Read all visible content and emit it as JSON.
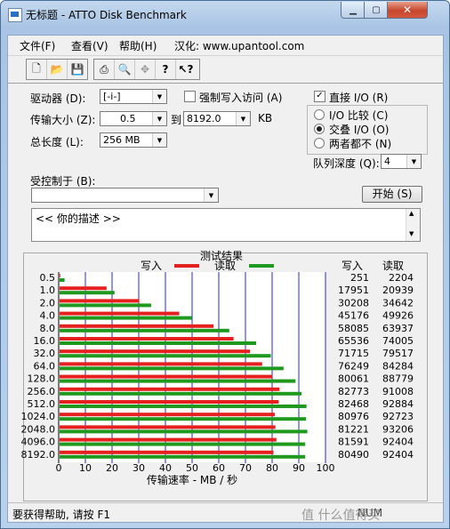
{
  "window": {
    "title": "无标题 - ATTO Disk Benchmark"
  },
  "menu": [
    "文件(F)",
    "查看(V)",
    "帮助(H)",
    "汉化: www.upantool.com"
  ],
  "toolbar": {
    "icons": [
      "new-file-icon",
      "open-folder-icon",
      "save-icon",
      "print-icon",
      "print-preview-icon",
      "move-icon",
      "help-icon",
      "context-help-icon"
    ]
  },
  "form": {
    "drive_label": "驱动器 (D):",
    "drive_value": "[-i-]",
    "force_write_label": "强制写入访问 (A)",
    "direct_io_label": "直接 I/O (R)",
    "direct_io_checked": true,
    "transfer_label": "传输大小 (Z):",
    "transfer_from": "0.5",
    "to_label": "到",
    "transfer_to": "8192.0",
    "kb_label": "KB",
    "length_label": "总长度 (L):",
    "length_value": "256 MB",
    "io_compare_label": "I/O 比较 (C)",
    "overlapped_io_label": "交叠 I/O (O)",
    "neither_label": "两者都不 (N)",
    "queue_depth_label": "队列深度 (Q):",
    "queue_depth_value": "4",
    "controlled_by_label": "受控制于 (B):",
    "start_button": "开始 (S)",
    "description_text": "<<  你的描述  >>"
  },
  "chart_data": {
    "type": "bar",
    "title": "测试结果",
    "legend": {
      "write": "写入",
      "read": "读取",
      "placement": "top"
    },
    "columns": {
      "write": "写入",
      "read": "读取"
    },
    "xlabel": "传输速率 - MB / 秒",
    "xlim": [
      0,
      100
    ],
    "xticks": [
      "0",
      "10",
      "20",
      "30",
      "40",
      "50",
      "60",
      "70",
      "80",
      "90",
      "100"
    ],
    "categories": [
      "0.5",
      "1.0",
      "2.0",
      "4.0",
      "8.0",
      "16.0",
      "32.0",
      "64.0",
      "128.0",
      "256.0",
      "512.0",
      "1024.0",
      "2048.0",
      "4096.0",
      "8192.0"
    ],
    "series": [
      {
        "name": "写入",
        "color": "#e61f1f",
        "values": [
          0.251,
          17.951,
          30.208,
          45.176,
          58.085,
          65.536,
          71.715,
          76.249,
          80.061,
          82.773,
          82.468,
          80.976,
          81.221,
          81.591,
          80.49
        ],
        "raw": [
          "251",
          "17951",
          "30208",
          "45176",
          "58085",
          "65536",
          "71715",
          "76249",
          "80061",
          "82773",
          "82468",
          "80976",
          "81221",
          "81591",
          "80490"
        ]
      },
      {
        "name": "读取",
        "color": "#1f9a1f",
        "values": [
          2.204,
          20.939,
          34.642,
          49.926,
          63.937,
          74.005,
          79.517,
          84.284,
          88.779,
          91.008,
          92.884,
          92.723,
          93.206,
          92.404,
          92.404
        ],
        "raw": [
          "2204",
          "20939",
          "34642",
          "49926",
          "63937",
          "74005",
          "79517",
          "84284",
          "88779",
          "91008",
          "92884",
          "92723",
          "93206",
          "92404",
          "92404"
        ]
      }
    ],
    "grid": true
  },
  "status": {
    "help_text": "要获得帮助, 请按 F1",
    "mode": "NUM"
  },
  "watermark": "值 什么值得买"
}
